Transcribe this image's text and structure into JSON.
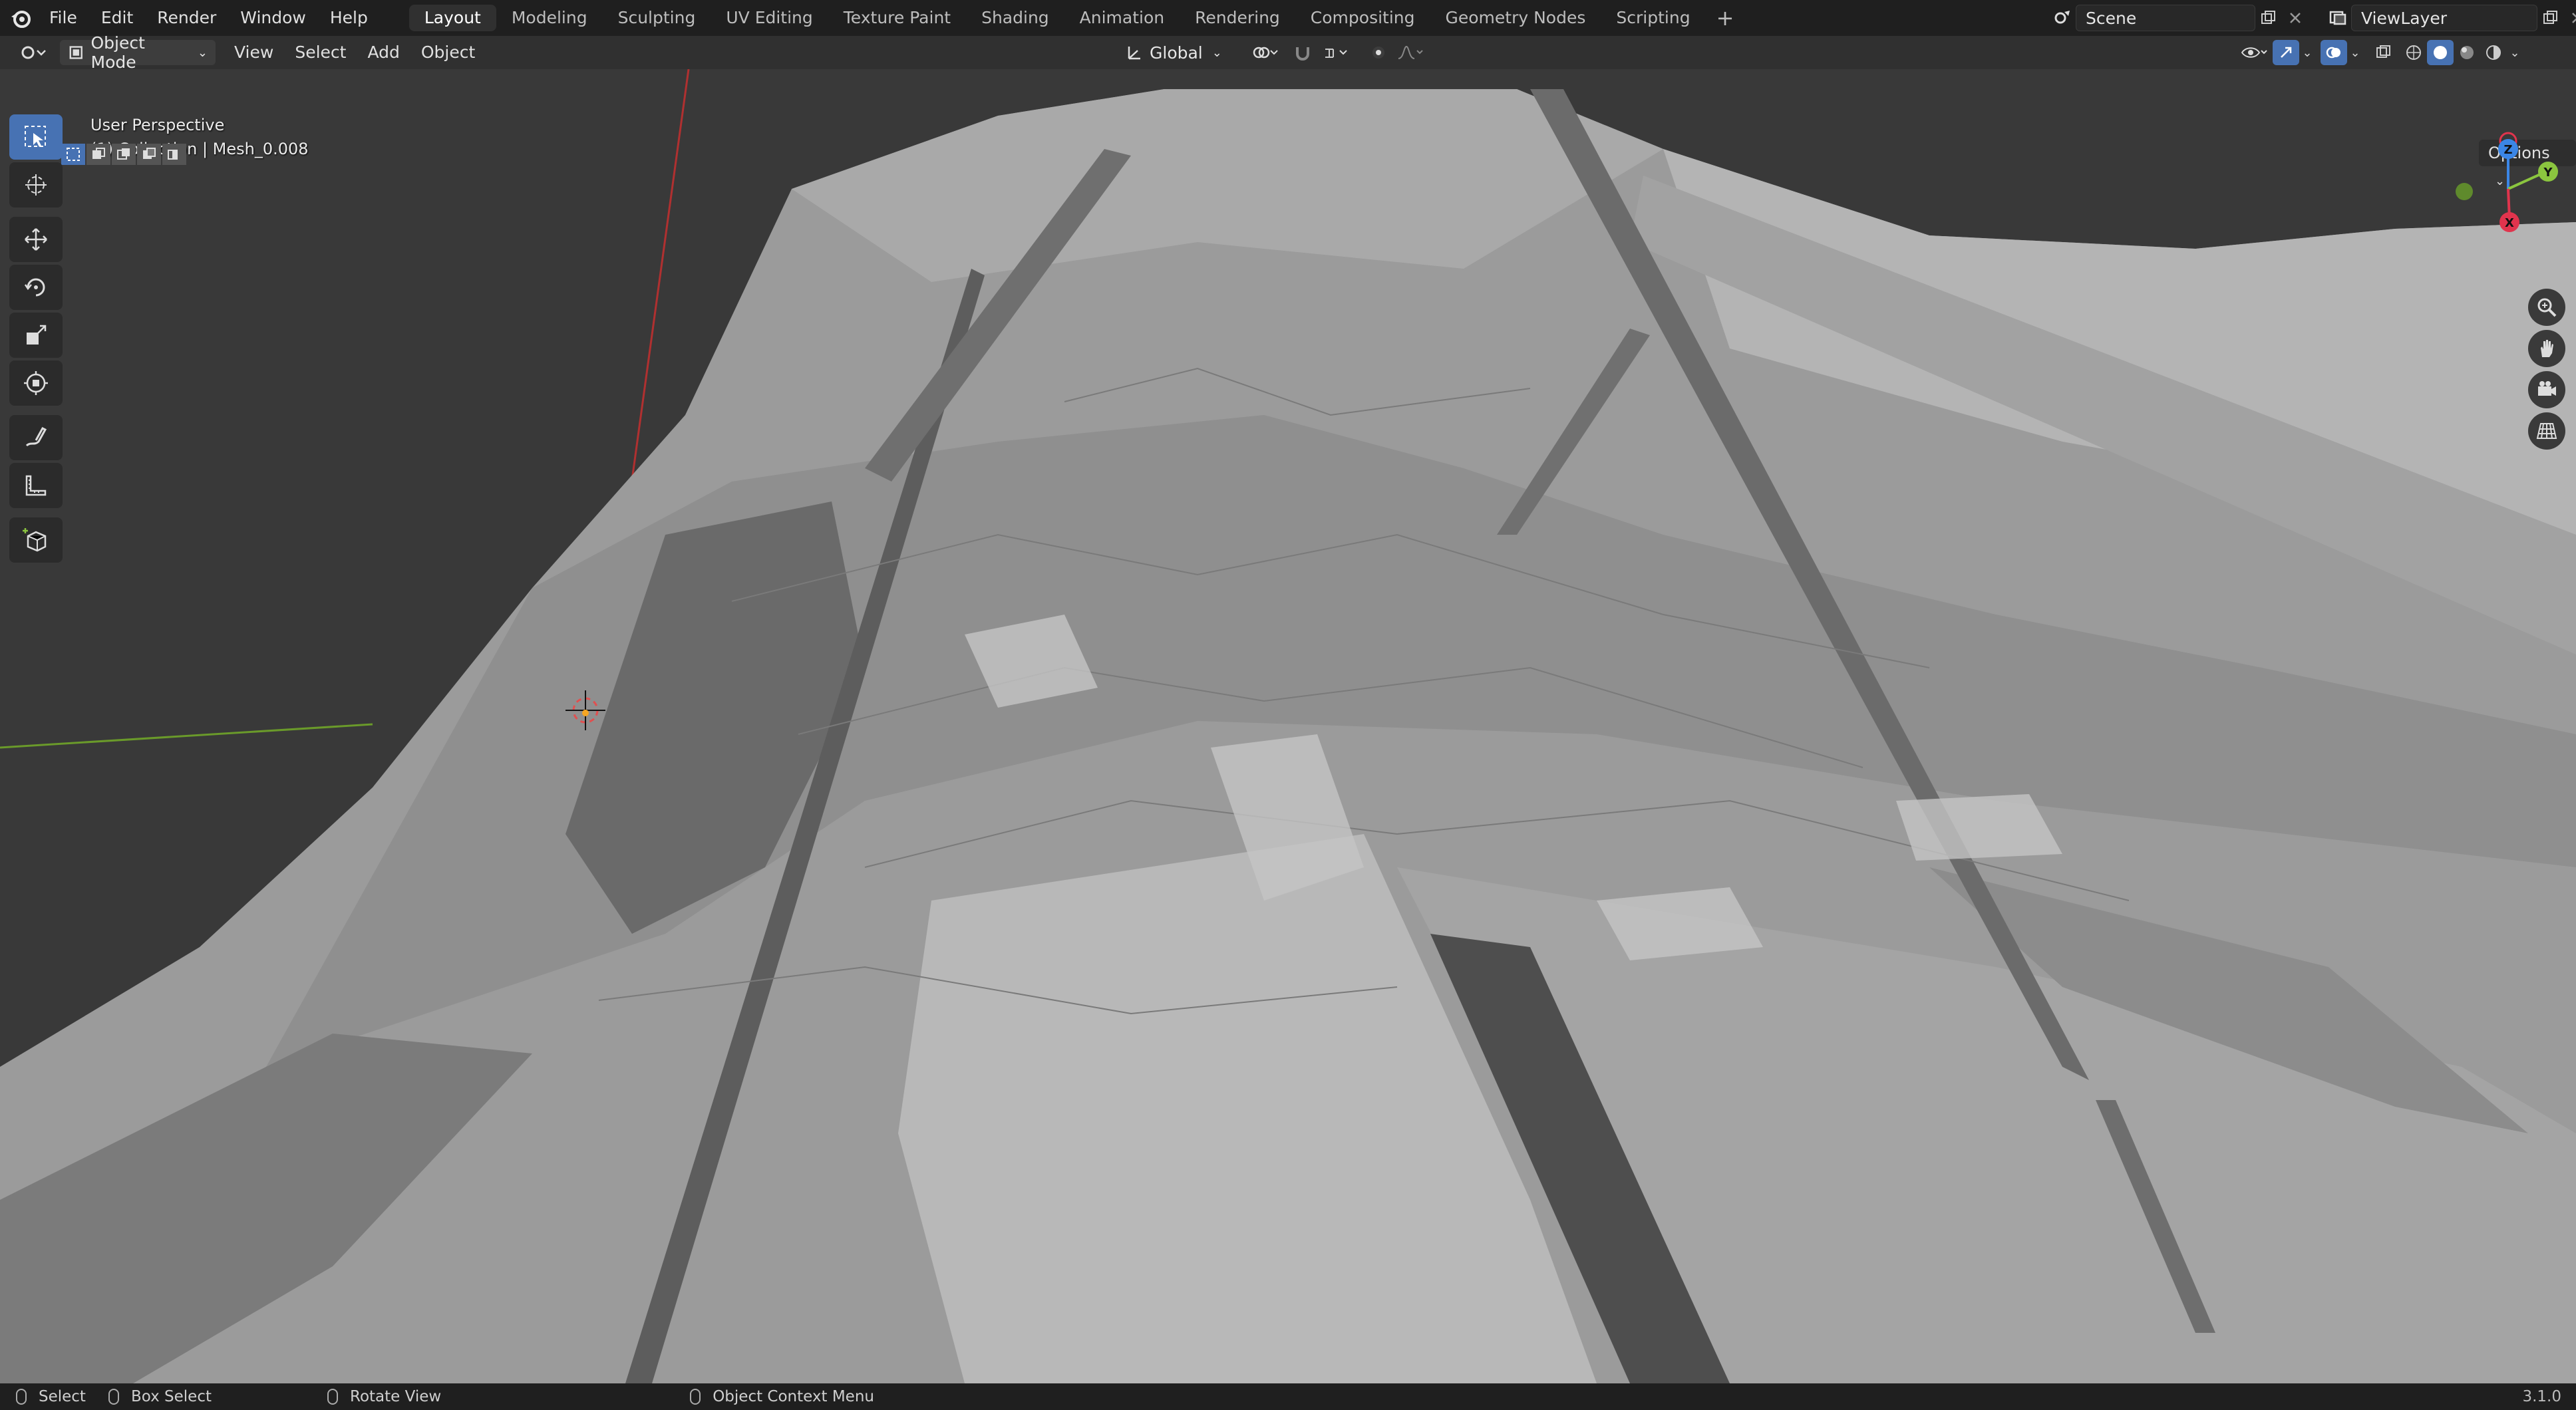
{
  "menu": {
    "items": [
      "File",
      "Edit",
      "Render",
      "Window",
      "Help"
    ]
  },
  "workspaces": {
    "tabs": [
      "Layout",
      "Modeling",
      "Sculpting",
      "UV Editing",
      "Texture Paint",
      "Shading",
      "Animation",
      "Rendering",
      "Compositing",
      "Geometry Nodes",
      "Scripting"
    ],
    "active": "Layout",
    "add_symbol": "+"
  },
  "scene": {
    "label": "Scene"
  },
  "view_layer": {
    "label": "ViewLayer"
  },
  "header": {
    "mode": "Object Mode",
    "view": "View",
    "select": "Select",
    "add": "Add",
    "object": "Object",
    "transform_orientation": "Global"
  },
  "viewport": {
    "perspective": "User Perspective",
    "collection": "(1) Collection | Mesh_0.008",
    "options": "Options",
    "gizmo_axes": {
      "x": "X",
      "y": "Y",
      "z": "Z"
    },
    "colors": {
      "x": "#e0344d",
      "y": "#8bc53f",
      "z": "#3b86e6",
      "active": "#4772b3"
    }
  },
  "toolbar": {
    "tools": [
      "select-box",
      "cursor",
      "move",
      "rotate",
      "scale",
      "transform",
      "annotate",
      "measure",
      "add-cube"
    ],
    "active": "select-box"
  },
  "statusbar": {
    "select": "Select",
    "box_select": "Box Select",
    "rotate_view": "Rotate View",
    "context_menu": "Object Context Menu",
    "version": "3.1.0"
  }
}
